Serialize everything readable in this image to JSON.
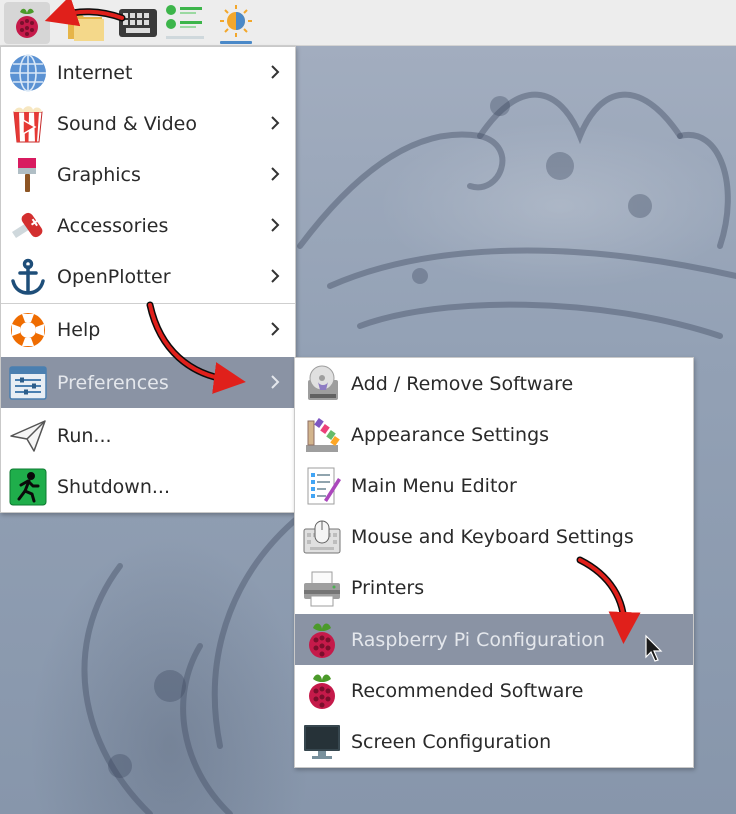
{
  "panel": {
    "icons": [
      "raspberry-menu-icon",
      "folder-icon",
      "keyboard-icon",
      "updates-icon",
      "brightness-icon"
    ]
  },
  "main_menu": {
    "items": [
      {
        "label": "Internet",
        "icon": "globe-icon",
        "has_submenu": true
      },
      {
        "label": "Sound & Video",
        "icon": "popcorn-icon",
        "has_submenu": true
      },
      {
        "label": "Graphics",
        "icon": "paintbrush-icon",
        "has_submenu": true
      },
      {
        "label": "Accessories",
        "icon": "swiss-knife-icon",
        "has_submenu": true
      },
      {
        "label": "OpenPlotter",
        "icon": "anchor-icon",
        "has_submenu": true
      },
      {
        "label": "Help",
        "icon": "lifebuoy-icon",
        "has_submenu": true
      },
      {
        "label": "Preferences",
        "icon": "preferences-sliders-icon",
        "has_submenu": true,
        "active": true
      },
      {
        "label": "Run...",
        "icon": "paper-plane-icon",
        "has_submenu": false
      },
      {
        "label": "Shutdown...",
        "icon": "exit-running-man-icon",
        "has_submenu": false
      }
    ]
  },
  "preferences_submenu": {
    "items": [
      {
        "label": "Add / Remove Software",
        "icon": "software-cd-icon"
      },
      {
        "label": "Appearance Settings",
        "icon": "appearance-palette-icon"
      },
      {
        "label": "Main Menu Editor",
        "icon": "menu-editor-icon"
      },
      {
        "label": "Mouse and Keyboard Settings",
        "icon": "mouse-keyboard-icon"
      },
      {
        "label": "Printers",
        "icon": "printer-icon"
      },
      {
        "label": "Raspberry Pi Configuration",
        "icon": "raspberry-icon",
        "active": true
      },
      {
        "label": "Recommended Software",
        "icon": "raspberry-icon"
      },
      {
        "label": "Screen Configuration",
        "icon": "monitor-icon"
      }
    ]
  },
  "colors": {
    "highlight": "#8a93a4",
    "annotation_arrow": "#e0201b",
    "panel_bg": "#ededed"
  }
}
